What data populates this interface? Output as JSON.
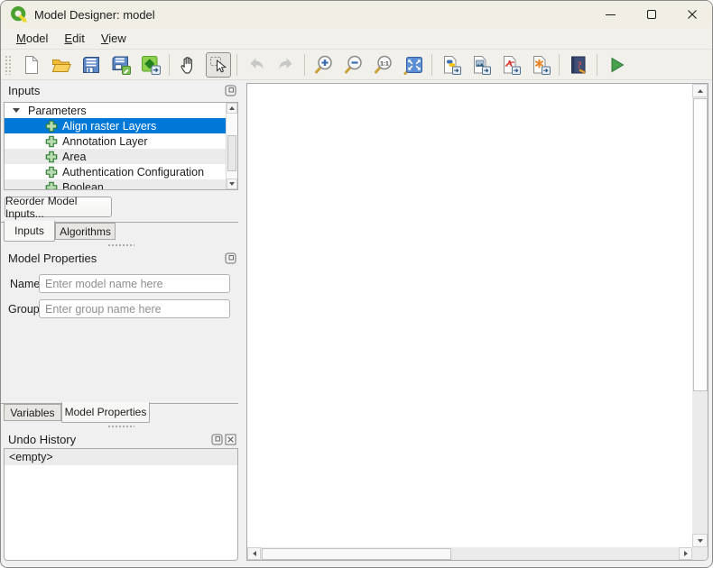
{
  "window": {
    "title": "Model Designer: model"
  },
  "menu": {
    "items": [
      {
        "label": "Model"
      },
      {
        "label": "Edit"
      },
      {
        "label": "View"
      }
    ]
  },
  "toolbar": {
    "buttons": [
      {
        "icon": "new-model-icon",
        "state": "enabled"
      },
      {
        "icon": "open-model-icon",
        "state": "enabled"
      },
      {
        "icon": "save-model-icon",
        "state": "enabled"
      },
      {
        "icon": "save-model-as-icon",
        "state": "enabled"
      },
      {
        "icon": "save-model-in-project-icon",
        "state": "enabled"
      },
      {
        "icon": "pan-icon",
        "state": "enabled"
      },
      {
        "icon": "select-icon",
        "state": "active"
      },
      {
        "icon": "undo-icon",
        "state": "disabled"
      },
      {
        "icon": "redo-icon",
        "state": "disabled"
      },
      {
        "icon": "zoom-in-icon",
        "state": "enabled"
      },
      {
        "icon": "zoom-out-icon",
        "state": "enabled"
      },
      {
        "icon": "zoom-actual-icon",
        "state": "enabled"
      },
      {
        "icon": "zoom-full-icon",
        "state": "enabled"
      },
      {
        "icon": "export-python-icon",
        "state": "enabled"
      },
      {
        "icon": "export-image-icon",
        "state": "enabled"
      },
      {
        "icon": "export-pdf-icon",
        "state": "enabled"
      },
      {
        "icon": "export-svg-icon",
        "state": "enabled"
      },
      {
        "icon": "help-icon",
        "state": "enabled"
      },
      {
        "icon": "run-model-icon",
        "state": "enabled"
      }
    ]
  },
  "inputs_panel": {
    "title": "Inputs",
    "tree": {
      "root": {
        "label": "Parameters",
        "expanded": true
      },
      "items": [
        {
          "label": "Align raster Layers",
          "selected": true
        },
        {
          "label": "Annotation Layer",
          "selected": false
        },
        {
          "label": "Area",
          "selected": false
        },
        {
          "label": "Authentication Configuration",
          "selected": false
        },
        {
          "label": "Boolean",
          "selected": false
        }
      ]
    },
    "reorder_button": "Reorder Model Inputs...",
    "tabs": [
      {
        "label": "Inputs",
        "active": true
      },
      {
        "label": "Algorithms",
        "active": false
      }
    ]
  },
  "model_properties_panel": {
    "title": "Model Properties",
    "name_label": "Name",
    "name_placeholder": "Enter model name here",
    "group_label": "Group",
    "group_placeholder": "Enter group name here",
    "tabs": [
      {
        "label": "Variables",
        "active": false
      },
      {
        "label": "Model Properties",
        "active": true
      }
    ]
  },
  "undo_panel": {
    "title": "Undo History",
    "items": [
      {
        "label": "<empty>",
        "selected": true
      }
    ]
  },
  "colors": {
    "selection_blue": "#0078d7",
    "titlebar_bg": "#f1eee5",
    "chrome_bg": "#f1f0ea",
    "accent_green": "#4ca22e"
  }
}
